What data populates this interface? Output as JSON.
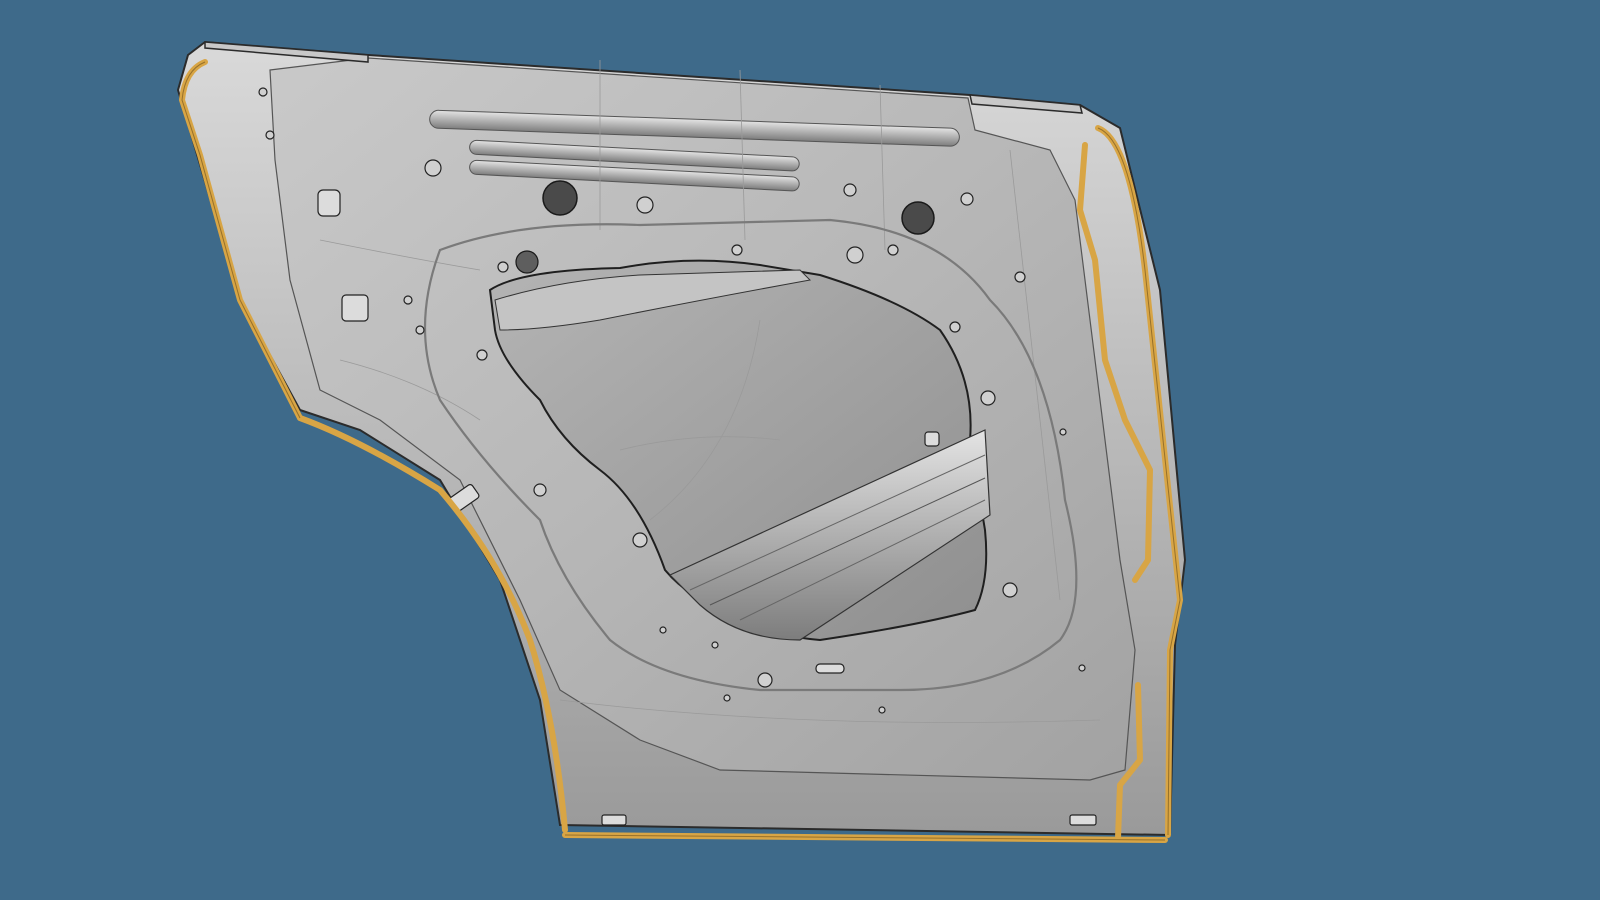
{
  "viewport": {
    "background_color": "#3e6a8a",
    "model": {
      "name": "rear-door-inner-panel",
      "panel_color": "#b7b7b7",
      "panel_shade_color": "#8e8e8e",
      "window_opening_color": "#a9a9a9",
      "sealer_bead_color": "#d8a545",
      "edge_line_color": "#2b2b2b",
      "mesh_line_color": "#9a9a9a"
    }
  }
}
